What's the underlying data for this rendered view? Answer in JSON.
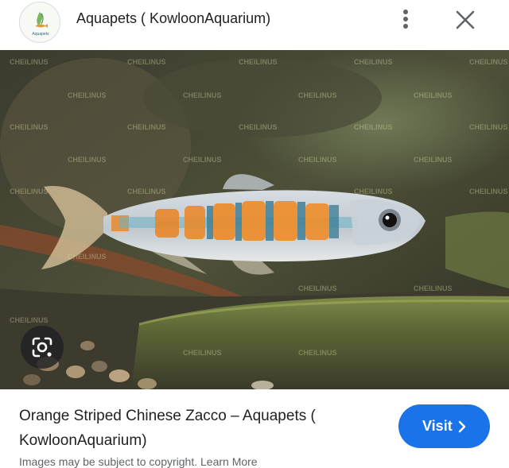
{
  "header": {
    "site_name": "Aquapets ( KowloonAquarium)",
    "logo_text": "Aquapets",
    "more_icon": "more-vert-icon",
    "close_icon": "close-icon"
  },
  "image": {
    "watermark": "CHEILINUS",
    "lens_icon": "lens-search-icon"
  },
  "result": {
    "title": "Orange Striped Chinese Zacco – Aquapets ( KowloonAquarium)",
    "visit_label": "Visit",
    "visit_icon": "chevron-right-icon",
    "caption": "Images may be subject to copyright. Learn More"
  },
  "colors": {
    "accent": "#1a73e8",
    "text": "#202124",
    "muted": "#5f6368"
  }
}
